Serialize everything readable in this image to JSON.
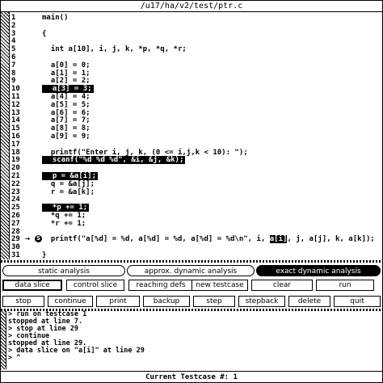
{
  "window_title": "/u17/ha/v2/test/ptr.c",
  "source_lines": [
    {
      "n": "1",
      "t": "main()"
    },
    {
      "n": "2",
      "t": ""
    },
    {
      "n": "3",
      "t": "{"
    },
    {
      "n": "4",
      "t": ""
    },
    {
      "n": "5",
      "t": "  int a[10], i, j, k, *p, *q, *r;"
    },
    {
      "n": "6",
      "t": ""
    },
    {
      "n": "7",
      "t": "  a[0] = 0;"
    },
    {
      "n": "8",
      "t": "  a[1] = 1;"
    },
    {
      "n": "9",
      "t": "  a[2] = 2;"
    },
    {
      "n": "10",
      "t": "  a[3] = 3;"
    },
    {
      "n": "11",
      "t": "  a[4] = 4;"
    },
    {
      "n": "12",
      "t": "  a[5] = 5;"
    },
    {
      "n": "13",
      "t": "  a[6] = 6;"
    },
    {
      "n": "14",
      "t": "  a[7] = 7;"
    },
    {
      "n": "15",
      "t": "  a[8] = 8;"
    },
    {
      "n": "16",
      "t": "  a[9] = 9;"
    },
    {
      "n": "17",
      "t": ""
    },
    {
      "n": "18",
      "t": "  printf(\"Enter i, j, k, (0 <= i,j,k < 10): \");"
    },
    {
      "n": "19",
      "t": "  scanf(\"%d %d %d\", &i, &j, &k);"
    },
    {
      "n": "20",
      "t": ""
    },
    {
      "n": "21",
      "t": "  p = &a[i];"
    },
    {
      "n": "22",
      "t": "  q = &a[j];"
    },
    {
      "n": "23",
      "t": "  r = &a[k];"
    },
    {
      "n": "24",
      "t": ""
    },
    {
      "n": "25",
      "t": "  *p += 1;"
    },
    {
      "n": "26",
      "t": "  *q += 1;"
    },
    {
      "n": "27",
      "t": "  *r += 1;"
    },
    {
      "n": "28",
      "t": ""
    },
    {
      "n": "29",
      "t": "  printf(\"a[%d] = %d, a[%d] = %d, a[%d] = %d\\n\", i, a[i], j, a[j], k, a[k]);"
    },
    {
      "n": "30",
      "t": ""
    },
    {
      "n": "31",
      "t": "}"
    },
    {
      "n": "32",
      "t": ""
    }
  ],
  "highlighted_lines": [
    "10",
    "19",
    "21",
    "25"
  ],
  "current_line": "29",
  "current_arrow": "→",
  "stop_marker": "S",
  "line29_parts": {
    "before": "  printf(\"a[%d] = %d, a[%d] = %d, a[%d] = %d\\n\", i, ",
    "selected": "a[i]",
    "after": ", j, a[j], k, a[k]);"
  },
  "tabs": [
    {
      "label": "static analysis",
      "active": false
    },
    {
      "label": "approx. dynamic analysis",
      "active": false
    },
    {
      "label": "exact dynamic analysis",
      "active": true
    }
  ],
  "buttons_row1": [
    {
      "label": "data slice",
      "selected": true
    },
    {
      "label": "control slice",
      "selected": false
    },
    {
      "label": "reaching defs",
      "selected": false
    },
    {
      "label": "new testcase",
      "selected": false
    },
    {
      "label": "clear",
      "selected": false
    },
    {
      "label": "run",
      "selected": false
    }
  ],
  "buttons_row2": [
    {
      "label": "stop"
    },
    {
      "label": "continue"
    },
    {
      "label": "print"
    },
    {
      "label": "backup"
    },
    {
      "label": "step"
    },
    {
      "label": "stepback"
    },
    {
      "label": "delete"
    },
    {
      "label": "quit"
    }
  ],
  "console_lines": [
    "> run on testcase 1",
    "stopped at line 7.",
    "> stop at line 29",
    "> continue",
    "stopped at line 29.",
    "> data slice on \"a[i]\" at line 29",
    "> ^"
  ],
  "status": "Current Testcase #: 1"
}
